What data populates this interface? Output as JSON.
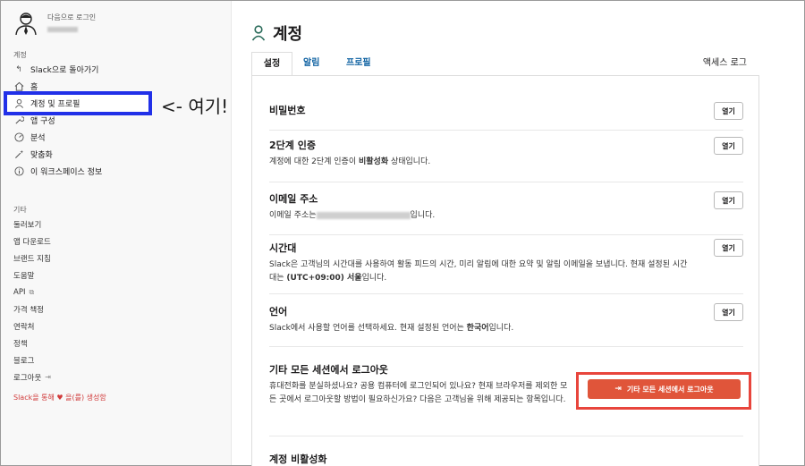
{
  "sidebar": {
    "signed_in_label": "다음으로 로그인",
    "section_account": "계정",
    "items": [
      {
        "label": "Slack으로 돌아가기"
      },
      {
        "label": "홈"
      },
      {
        "label": "계정 및 프로필"
      },
      {
        "label": "앱 구성"
      },
      {
        "label": "분석"
      },
      {
        "label": "맞춤화"
      },
      {
        "label": "이 워크스페이스 정보"
      }
    ],
    "section_other": "기타",
    "other_items": [
      {
        "label": "둘러보기"
      },
      {
        "label": "앱 다운로드"
      },
      {
        "label": "브랜드 지침"
      },
      {
        "label": "도움말"
      },
      {
        "label": "API"
      },
      {
        "label": "가격 책정"
      },
      {
        "label": "연락처"
      },
      {
        "label": "정책"
      },
      {
        "label": "블로그"
      },
      {
        "label": "로그아웃"
      }
    ],
    "made_with": "Slack을 통해 ♥ 을(를) 생성함"
  },
  "annotation": "<- 여기!",
  "page": {
    "title": "계정",
    "tabs": {
      "settings": "설정",
      "alerts": "알림",
      "profile": "프로필",
      "access_log": "액세스 로그"
    }
  },
  "sections": {
    "password": {
      "title": "비밀번호",
      "button": "열기"
    },
    "twofa": {
      "title": "2단계 인증",
      "desc_pre": "계정에 대한 2단계 인증이 ",
      "desc_bold": "비활성화",
      "desc_post": " 상태입니다.",
      "button": "열기"
    },
    "email": {
      "title": "이메일 주소",
      "desc_pre": "이메일 주소는",
      "desc_post": "입니다.",
      "button": "열기"
    },
    "timezone": {
      "title": "시간대",
      "desc_pre": "Slack은 고객님의 시간대를 사용하여 활동 피드의 시간, 미리 알림에 대한 요약 및 알림 이메일을 보냅니다. 현재 설정된 시간대는 ",
      "desc_bold": "(UTC+09:00) 서울",
      "desc_post": "입니다.",
      "button": "열기"
    },
    "language": {
      "title": "언어",
      "desc_pre": "Slack에서 사용할 언어를 선택하세요. 현재 설정된 언어는 ",
      "desc_bold": "한국어",
      "desc_post": "입니다.",
      "button": "열기"
    },
    "signout": {
      "title": "기타 모든 세션에서 로그아웃",
      "desc": "휴대전화를 분실하셨나요? 공용 컴퓨터에 로그인되어 있나요? 현재 브라우저를 제외한 모든 곳에서 로그아웃할 방법이 필요하신가요? 다음은 고객님을 위해 제공되는 항목입니다.",
      "button": "기타 모든 세션에서 로그아웃"
    },
    "deactivate": {
      "title": "계정 비활성화"
    }
  }
}
